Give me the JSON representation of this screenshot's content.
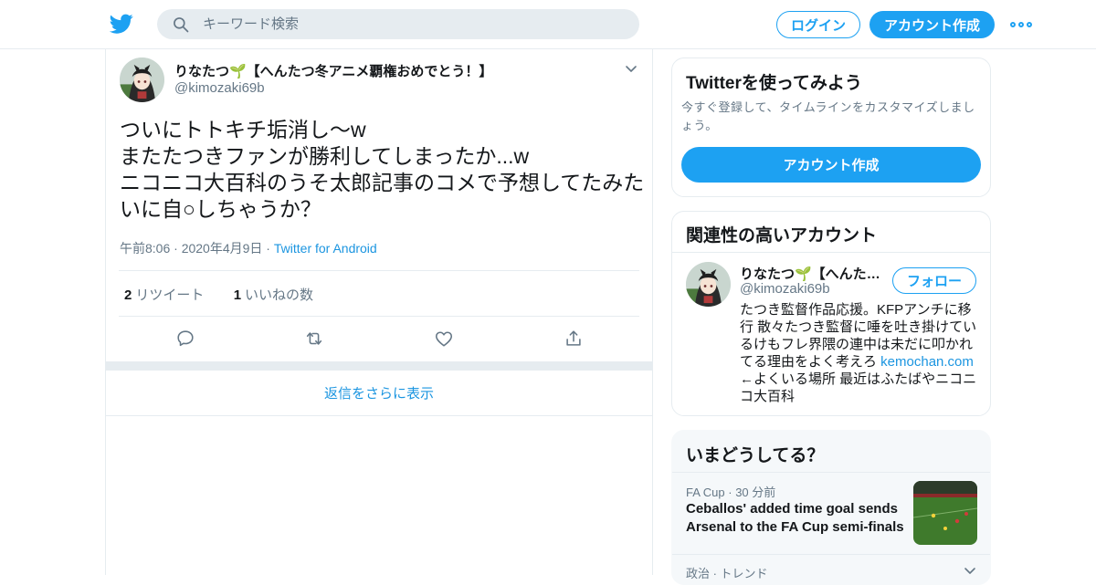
{
  "header": {
    "search_placeholder": "キーワード検索",
    "login_label": "ログイン",
    "signup_label": "アカウント作成"
  },
  "tweet": {
    "display_name": "りなたつ🌱【へんたつ冬アニメ覇権おめでとう！】",
    "handle": "@kimozaki69b",
    "text": "ついにトトキチ垢消し～w\nまたたつきファンが勝利してしまったか...w\nニコニコ大百科のうそ太郎記事のコメで予想してたみたいに自○しちゃうか？",
    "time": "午前8:06",
    "date": "2020年4月9日",
    "source": "Twitter for Android",
    "retweet_count": "2",
    "retweet_label": "リツイート",
    "like_count": "1",
    "like_label": "いいねの数",
    "more_replies_label": "返信をさらに表示"
  },
  "sidebar": {
    "signup_card": {
      "title": "Twitterを使ってみよう",
      "description": "今すぐ登録して、タイムラインをカスタマイズしましょう。",
      "button_label": "アカウント作成"
    },
    "related_card": {
      "title": "関連性の高いアカウント",
      "name": "りなたつ🌱【へんたつ冬アニメ覇権おめでとう！】",
      "handle": "@kimozaki69b",
      "follow_label": "フォロー",
      "bio_before": "たつき監督作品応援。KFPアンチに移行 散々たつき監督に唾を吐き掛けているけもフレ界隈の連中は未だに叩かれてる理由をよく考えろ ",
      "bio_link": "kemochan.com",
      "bio_after": " ←よくいる場所 最近はふたばやニコニコ大百科"
    },
    "trends_card": {
      "title": "いまどうしてる？",
      "trend1_category": "FA Cup",
      "trend1_time": "30 分前",
      "trend1_headline": "Ceballos' added time goal sends Arsenal to the FA Cup semi-finals",
      "trend2_meta": "政治 · トレンド"
    }
  },
  "colors": {
    "accent": "#1da1f2",
    "link": "#1b95e0",
    "muted": "#657786",
    "border": "#e6ecf0"
  },
  "icons": [
    "twitter-bird-icon",
    "search-icon",
    "more-dots-icon",
    "chevron-down-icon",
    "reply-icon",
    "retweet-icon",
    "like-icon",
    "share-icon"
  ]
}
